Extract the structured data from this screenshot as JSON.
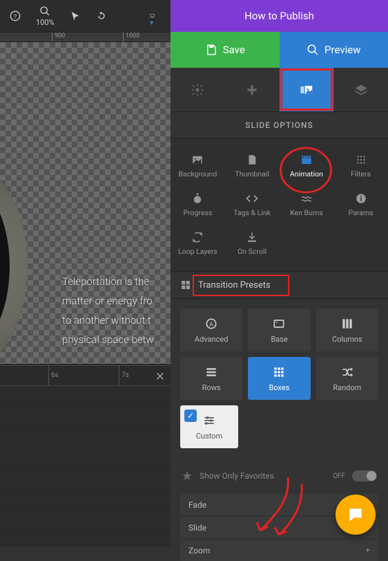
{
  "toolbar": {
    "zoom_level": "100%",
    "ruler_ticks": [
      "900",
      "1000"
    ]
  },
  "canvas": {
    "text": "Teleportation is the\nmatter or energy fro\nto another without t\nphysical space betw",
    "time_ticks": [
      "6s",
      "7s"
    ]
  },
  "header": {
    "publish": "How to Publish",
    "save": "Save",
    "preview": "Preview"
  },
  "slide_options_title": "SLIDE OPTIONS",
  "options": [
    {
      "label": "Background",
      "icon": "image"
    },
    {
      "label": "Thumbnail",
      "icon": "file"
    },
    {
      "label": "Animation",
      "icon": "clapper",
      "active": true
    },
    {
      "label": "Filters",
      "icon": "grid-dots"
    },
    {
      "label": "Progress",
      "icon": "stopwatch"
    },
    {
      "label": "Tags & Link",
      "icon": "code"
    },
    {
      "label": "Ken Burns",
      "icon": "waves"
    },
    {
      "label": "Params",
      "icon": "info"
    },
    {
      "label": "Loop Layers",
      "icon": "loop"
    },
    {
      "label": "On Scroll",
      "icon": "download"
    }
  ],
  "section": {
    "transition_presets": "Transition Presets"
  },
  "presets": [
    [
      {
        "label": "Advanced",
        "icon": "advanced"
      },
      {
        "label": "Base",
        "icon": "base"
      },
      {
        "label": "Columns",
        "icon": "columns"
      }
    ],
    [
      {
        "label": "Rows",
        "icon": "rows"
      },
      {
        "label": "Boxes",
        "icon": "boxes",
        "active": true
      },
      {
        "label": "Random",
        "icon": "random"
      }
    ],
    [
      {
        "label": "Custom",
        "icon": "sliders",
        "custom": true
      }
    ]
  ],
  "favorites": {
    "label": "Show Only Favorites",
    "state": "OFF"
  },
  "transition_list": [
    "Fade",
    "Slide",
    "Zoom"
  ]
}
